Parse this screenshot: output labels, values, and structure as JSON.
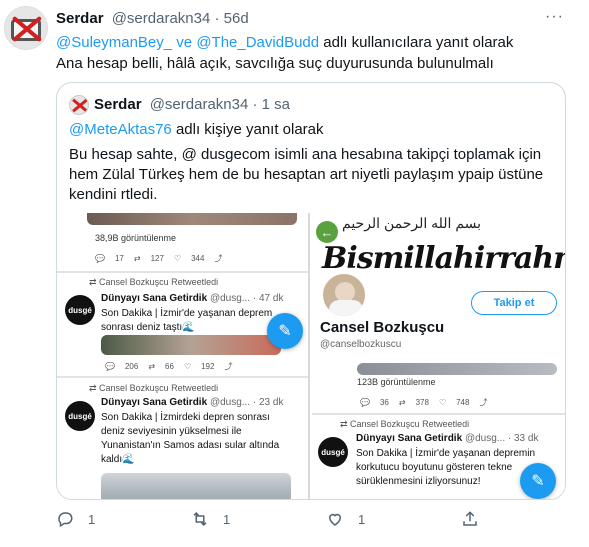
{
  "tweet": {
    "name": "Serdar",
    "handle": "@serdarakn34 · 56d",
    "replying_prefix": "",
    "replying_user1": "@SuleymanBey_",
    "replying_and": " ve ",
    "replying_user2": "@The_DavidBudd",
    "replying_suffix": " adlı kullanıcılara yanıt olarak",
    "text": "Ana hesap belli, hâlâ açık, savcılığa suç duyurusunda bulunulmalı",
    "more": "···"
  },
  "quote": {
    "name": "Serdar",
    "handle": "@serdarakn34 · 1 sa",
    "replying_user": "@MeteAktas76",
    "replying_suffix": " adlı kişiye yanıt olarak",
    "text": "Bu hesap sahte, @ dusgecom isimli ana hesabına takipçi toplamak için hem Zülal Türkeş hem de bu hesaptan art niyetli paylaşım ypaip üstüne kendini rtledi."
  },
  "left_panel": {
    "top_views": "38,9B görüntülenme",
    "top_actions": [
      "17",
      "127",
      "344"
    ],
    "retweet_label": "Cansel Bozkuşcu Retweetledi",
    "post1": {
      "avatar_text": "dusgé",
      "name": "Dünyayı Sana Getirdik",
      "meta": "@dusg... · 47 dk",
      "text": "Son Dakika | İzmir'de yaşanan deprem sonrası deniz taştı🌊",
      "actions": [
        "206",
        "66",
        "192"
      ]
    },
    "retweet_label2": "Cansel Bozkuşcu Retweetledi",
    "post2": {
      "avatar_text": "dusgé",
      "name": "Dünyayı Sana Getirdik",
      "meta": "@dusg... · 23 dk",
      "text": "Son Dakika | İzmirdeki depren sonrası deniz seviyesinin yükselmesi ile Yunanistan'ın Samos adası sular altında kaldı🌊"
    }
  },
  "right_panel": {
    "arabic": "بسم الله الرحمن الرحيم",
    "calligraphy": "Bismillahirrahmanirrahim",
    "follow_button": "Takip et",
    "profile_name": "Cansel Bozkuşcu",
    "profile_handle": "@canselbozkuscu",
    "views": "123B görüntülenme",
    "actions": [
      "36",
      "378",
      "748"
    ],
    "retweet_label": "Cansel Bozkuşcu Retweetledi",
    "post": {
      "avatar_text": "dusgé",
      "name": "Dünyayı Sana Getirdik",
      "meta": "@dusg... · 33 dk",
      "text": "Son Dakika | İzmir'de yaşanan depremin korkutucu boyutunu gösteren tekne sürüklenmesini izliyorsunuz!"
    }
  },
  "actions": {
    "reply_count": "1",
    "retweet_count": "1",
    "like_count": "1"
  }
}
